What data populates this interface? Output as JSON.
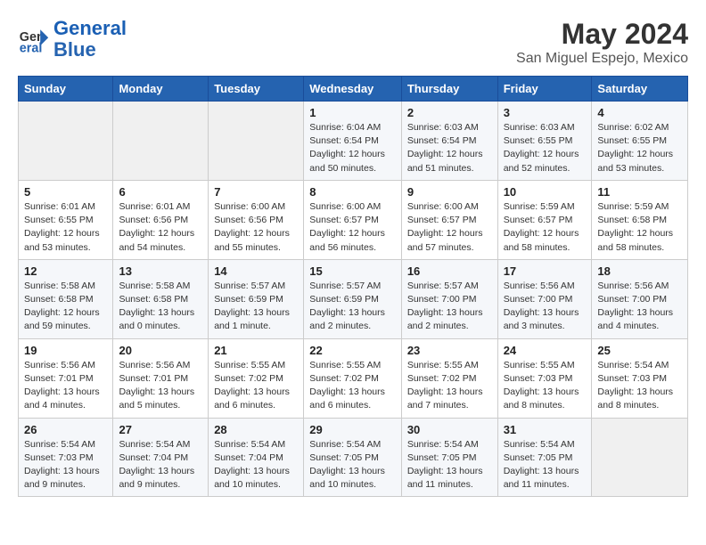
{
  "header": {
    "logo_line1": "General",
    "logo_line2": "Blue",
    "month_year": "May 2024",
    "location": "San Miguel Espejo, Mexico"
  },
  "weekdays": [
    "Sunday",
    "Monday",
    "Tuesday",
    "Wednesday",
    "Thursday",
    "Friday",
    "Saturday"
  ],
  "weeks": [
    [
      {
        "day": "",
        "info": ""
      },
      {
        "day": "",
        "info": ""
      },
      {
        "day": "",
        "info": ""
      },
      {
        "day": "1",
        "info": "Sunrise: 6:04 AM\nSunset: 6:54 PM\nDaylight: 12 hours\nand 50 minutes."
      },
      {
        "day": "2",
        "info": "Sunrise: 6:03 AM\nSunset: 6:54 PM\nDaylight: 12 hours\nand 51 minutes."
      },
      {
        "day": "3",
        "info": "Sunrise: 6:03 AM\nSunset: 6:55 PM\nDaylight: 12 hours\nand 52 minutes."
      },
      {
        "day": "4",
        "info": "Sunrise: 6:02 AM\nSunset: 6:55 PM\nDaylight: 12 hours\nand 53 minutes."
      }
    ],
    [
      {
        "day": "5",
        "info": "Sunrise: 6:01 AM\nSunset: 6:55 PM\nDaylight: 12 hours\nand 53 minutes."
      },
      {
        "day": "6",
        "info": "Sunrise: 6:01 AM\nSunset: 6:56 PM\nDaylight: 12 hours\nand 54 minutes."
      },
      {
        "day": "7",
        "info": "Sunrise: 6:00 AM\nSunset: 6:56 PM\nDaylight: 12 hours\nand 55 minutes."
      },
      {
        "day": "8",
        "info": "Sunrise: 6:00 AM\nSunset: 6:57 PM\nDaylight: 12 hours\nand 56 minutes."
      },
      {
        "day": "9",
        "info": "Sunrise: 6:00 AM\nSunset: 6:57 PM\nDaylight: 12 hours\nand 57 minutes."
      },
      {
        "day": "10",
        "info": "Sunrise: 5:59 AM\nSunset: 6:57 PM\nDaylight: 12 hours\nand 58 minutes."
      },
      {
        "day": "11",
        "info": "Sunrise: 5:59 AM\nSunset: 6:58 PM\nDaylight: 12 hours\nand 58 minutes."
      }
    ],
    [
      {
        "day": "12",
        "info": "Sunrise: 5:58 AM\nSunset: 6:58 PM\nDaylight: 12 hours\nand 59 minutes."
      },
      {
        "day": "13",
        "info": "Sunrise: 5:58 AM\nSunset: 6:58 PM\nDaylight: 13 hours\nand 0 minutes."
      },
      {
        "day": "14",
        "info": "Sunrise: 5:57 AM\nSunset: 6:59 PM\nDaylight: 13 hours\nand 1 minute."
      },
      {
        "day": "15",
        "info": "Sunrise: 5:57 AM\nSunset: 6:59 PM\nDaylight: 13 hours\nand 2 minutes."
      },
      {
        "day": "16",
        "info": "Sunrise: 5:57 AM\nSunset: 7:00 PM\nDaylight: 13 hours\nand 2 minutes."
      },
      {
        "day": "17",
        "info": "Sunrise: 5:56 AM\nSunset: 7:00 PM\nDaylight: 13 hours\nand 3 minutes."
      },
      {
        "day": "18",
        "info": "Sunrise: 5:56 AM\nSunset: 7:00 PM\nDaylight: 13 hours\nand 4 minutes."
      }
    ],
    [
      {
        "day": "19",
        "info": "Sunrise: 5:56 AM\nSunset: 7:01 PM\nDaylight: 13 hours\nand 4 minutes."
      },
      {
        "day": "20",
        "info": "Sunrise: 5:56 AM\nSunset: 7:01 PM\nDaylight: 13 hours\nand 5 minutes."
      },
      {
        "day": "21",
        "info": "Sunrise: 5:55 AM\nSunset: 7:02 PM\nDaylight: 13 hours\nand 6 minutes."
      },
      {
        "day": "22",
        "info": "Sunrise: 5:55 AM\nSunset: 7:02 PM\nDaylight: 13 hours\nand 6 minutes."
      },
      {
        "day": "23",
        "info": "Sunrise: 5:55 AM\nSunset: 7:02 PM\nDaylight: 13 hours\nand 7 minutes."
      },
      {
        "day": "24",
        "info": "Sunrise: 5:55 AM\nSunset: 7:03 PM\nDaylight: 13 hours\nand 8 minutes."
      },
      {
        "day": "25",
        "info": "Sunrise: 5:54 AM\nSunset: 7:03 PM\nDaylight: 13 hours\nand 8 minutes."
      }
    ],
    [
      {
        "day": "26",
        "info": "Sunrise: 5:54 AM\nSunset: 7:03 PM\nDaylight: 13 hours\nand 9 minutes."
      },
      {
        "day": "27",
        "info": "Sunrise: 5:54 AM\nSunset: 7:04 PM\nDaylight: 13 hours\nand 9 minutes."
      },
      {
        "day": "28",
        "info": "Sunrise: 5:54 AM\nSunset: 7:04 PM\nDaylight: 13 hours\nand 10 minutes."
      },
      {
        "day": "29",
        "info": "Sunrise: 5:54 AM\nSunset: 7:05 PM\nDaylight: 13 hours\nand 10 minutes."
      },
      {
        "day": "30",
        "info": "Sunrise: 5:54 AM\nSunset: 7:05 PM\nDaylight: 13 hours\nand 11 minutes."
      },
      {
        "day": "31",
        "info": "Sunrise: 5:54 AM\nSunset: 7:05 PM\nDaylight: 13 hours\nand 11 minutes."
      },
      {
        "day": "",
        "info": ""
      }
    ]
  ]
}
